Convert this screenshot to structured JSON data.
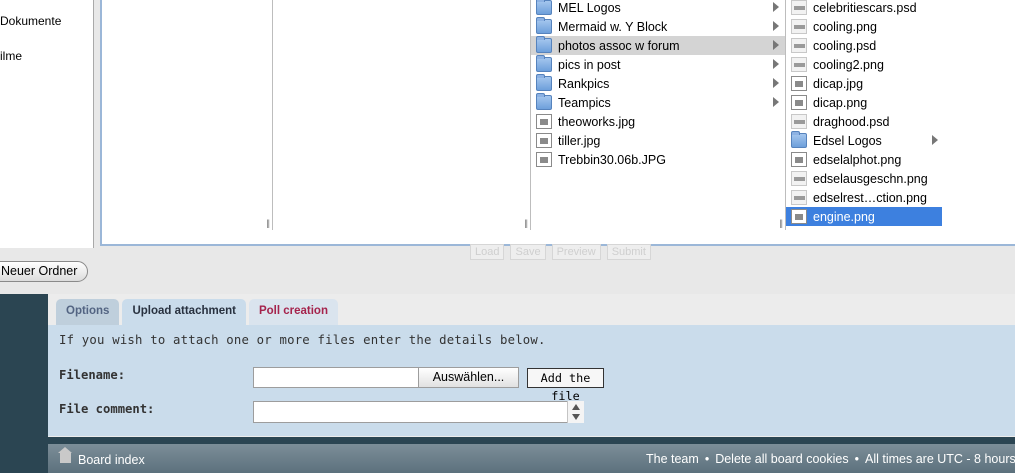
{
  "sidebar": {
    "items": [
      "Dokumente",
      "ilme"
    ]
  },
  "column3": {
    "items": [
      {
        "label": "MEL Logos",
        "type": "folder"
      },
      {
        "label": "Mermaid w. Y Block",
        "type": "folder"
      },
      {
        "label": "photos assoc w forum",
        "type": "folder"
      },
      {
        "label": "pics in post",
        "type": "folder"
      },
      {
        "label": "Rankpics",
        "type": "folder"
      },
      {
        "label": "Teampics",
        "type": "folder"
      },
      {
        "label": "theoworks.jpg",
        "type": "file"
      },
      {
        "label": "tiller.jpg",
        "type": "file"
      },
      {
        "label": "Trebbin30.06b.JPG",
        "type": "file"
      }
    ]
  },
  "column4": {
    "items": [
      {
        "label": "celebritiescars.psd",
        "type": "thumb"
      },
      {
        "label": "cooling.png",
        "type": "thumb"
      },
      {
        "label": "cooling.psd",
        "type": "thumb"
      },
      {
        "label": "cooling2.png",
        "type": "thumb"
      },
      {
        "label": "dicap.jpg",
        "type": "file"
      },
      {
        "label": "dicap.png",
        "type": "file"
      },
      {
        "label": "draghood.psd",
        "type": "thumb"
      },
      {
        "label": "Edsel Logos",
        "type": "folder"
      },
      {
        "label": "edselalphot.png",
        "type": "file"
      },
      {
        "label": "edselausgeschn.png",
        "type": "thumb"
      },
      {
        "label": "edselrest…ction.png",
        "type": "thumb"
      },
      {
        "label": "engine.png",
        "type": "file"
      }
    ]
  },
  "dialog": {
    "ghost_buttons": [
      "Load",
      "Save",
      "Preview",
      "Submit"
    ],
    "new_folder_label": "Neuer Ordner"
  },
  "tabs": [
    "Options",
    "Upload attachment",
    "Poll creation"
  ],
  "upload": {
    "intro": "If you wish to attach one or more files enter the details below.",
    "filename_label": "Filename:",
    "choose_label": "Auswählen...",
    "add_label": "Add the file",
    "comment_label": "File comment:"
  },
  "footer": {
    "board_index": "Board index",
    "team": "The team",
    "delete_cookies": "Delete all board cookies",
    "times": "All times are UTC - 8 hours",
    "separator": "•"
  }
}
